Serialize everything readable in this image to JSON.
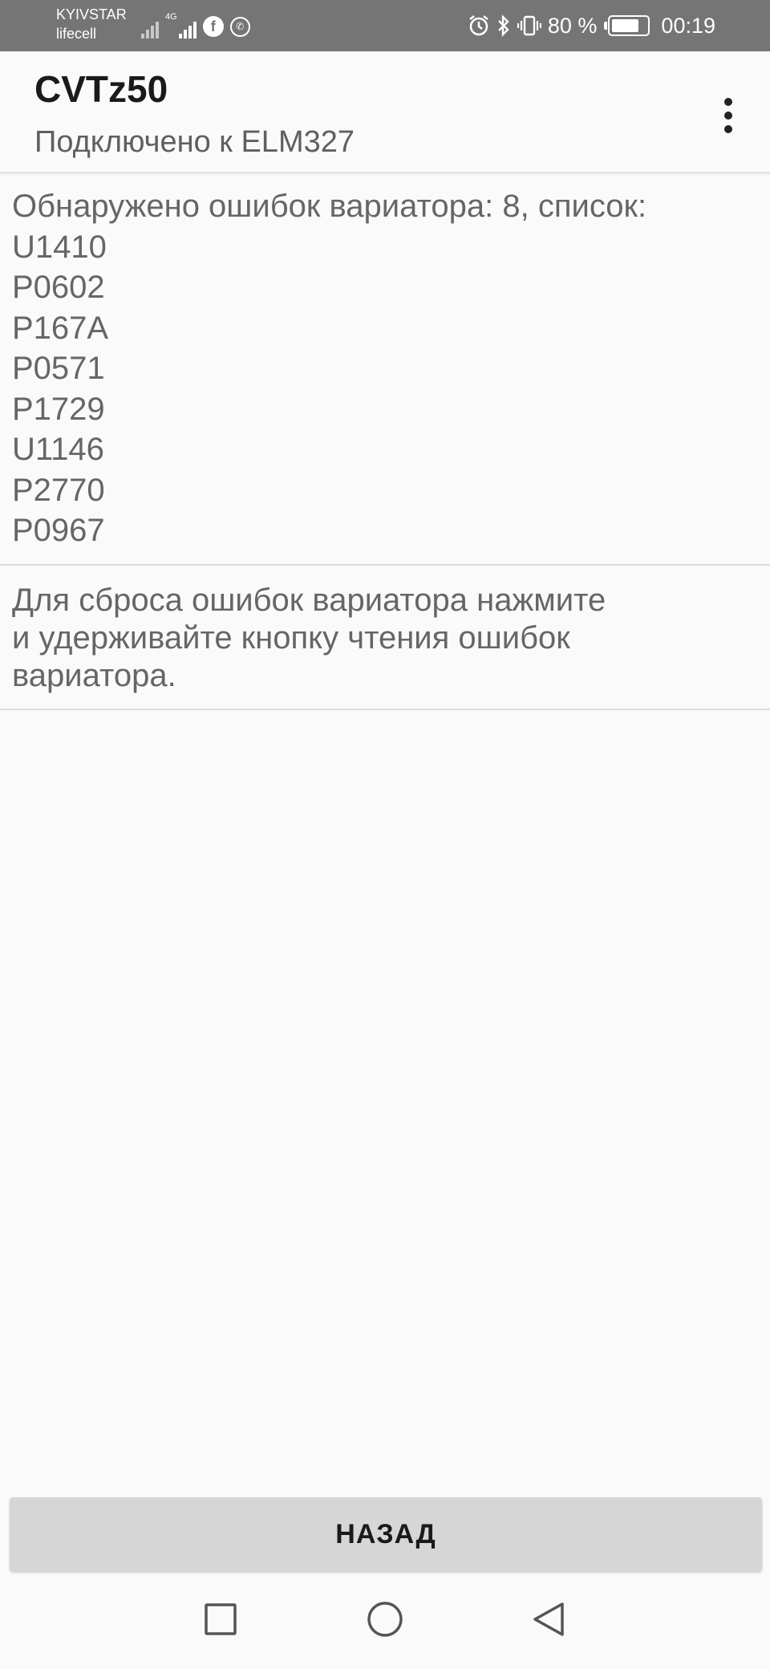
{
  "status_bar": {
    "carrier_1": "KYIVSTAR",
    "carrier_2": "lifecell",
    "network_tag": "4G",
    "battery_percent": "80 %",
    "battery_level": 0.8,
    "time": "00:19",
    "icons": [
      "signal-icon",
      "signal-4g-icon",
      "facebook-icon",
      "viber-icon",
      "alarm-icon",
      "bluetooth-icon",
      "vibrate-icon",
      "battery-icon"
    ]
  },
  "app_bar": {
    "title": "CVTz50",
    "subtitle": "Подключено к ELM327",
    "menu_icon": "more-vert-icon"
  },
  "errors": {
    "header": "Обнаружено ошибок вариатора: 8, список:",
    "codes": [
      "U1410",
      "P0602",
      "P167A",
      "P0571",
      "P1729",
      "U1146",
      "P2770",
      "P0967"
    ]
  },
  "hint": {
    "lines": [
      "Для сброса ошибок вариатора нажмите",
      "и удерживайте кнопку чтения ошибок",
      "вариатора."
    ]
  },
  "back_button": {
    "label": "НАЗАД"
  },
  "nav_bar": {
    "icons": [
      "recents-square-icon",
      "home-circle-icon",
      "back-triangle-icon"
    ]
  }
}
